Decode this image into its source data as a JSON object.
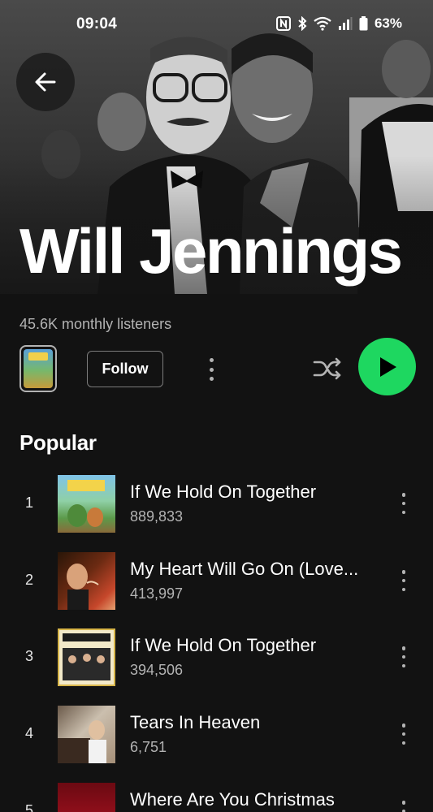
{
  "status_bar": {
    "time": "09:04",
    "battery": "63%",
    "icons": [
      "nfc-icon",
      "bluetooth-icon",
      "wifi-icon",
      "signal-icon",
      "battery-icon"
    ]
  },
  "header": {
    "artist_name": "Will Jennings",
    "back_icon": "arrow-left-icon"
  },
  "info": {
    "monthly_listeners": "45.6K monthly listeners",
    "follow_label": "Follow"
  },
  "colors": {
    "accent": "#1ed760",
    "background": "#121212",
    "secondary_text": "#b3b3b3"
  },
  "popular": {
    "title": "Popular",
    "tracks": [
      {
        "number": "1",
        "title": "If We Hold On Together",
        "plays": "889,833"
      },
      {
        "number": "2",
        "title": "My Heart Will Go On (Love...",
        "plays": "413,997"
      },
      {
        "number": "3",
        "title": "If We Hold On Together",
        "plays": "394,506"
      },
      {
        "number": "4",
        "title": "Tears In Heaven",
        "plays": "6,751"
      },
      {
        "number": "5",
        "title": "Where Are You Christmas",
        "plays": ""
      }
    ]
  }
}
